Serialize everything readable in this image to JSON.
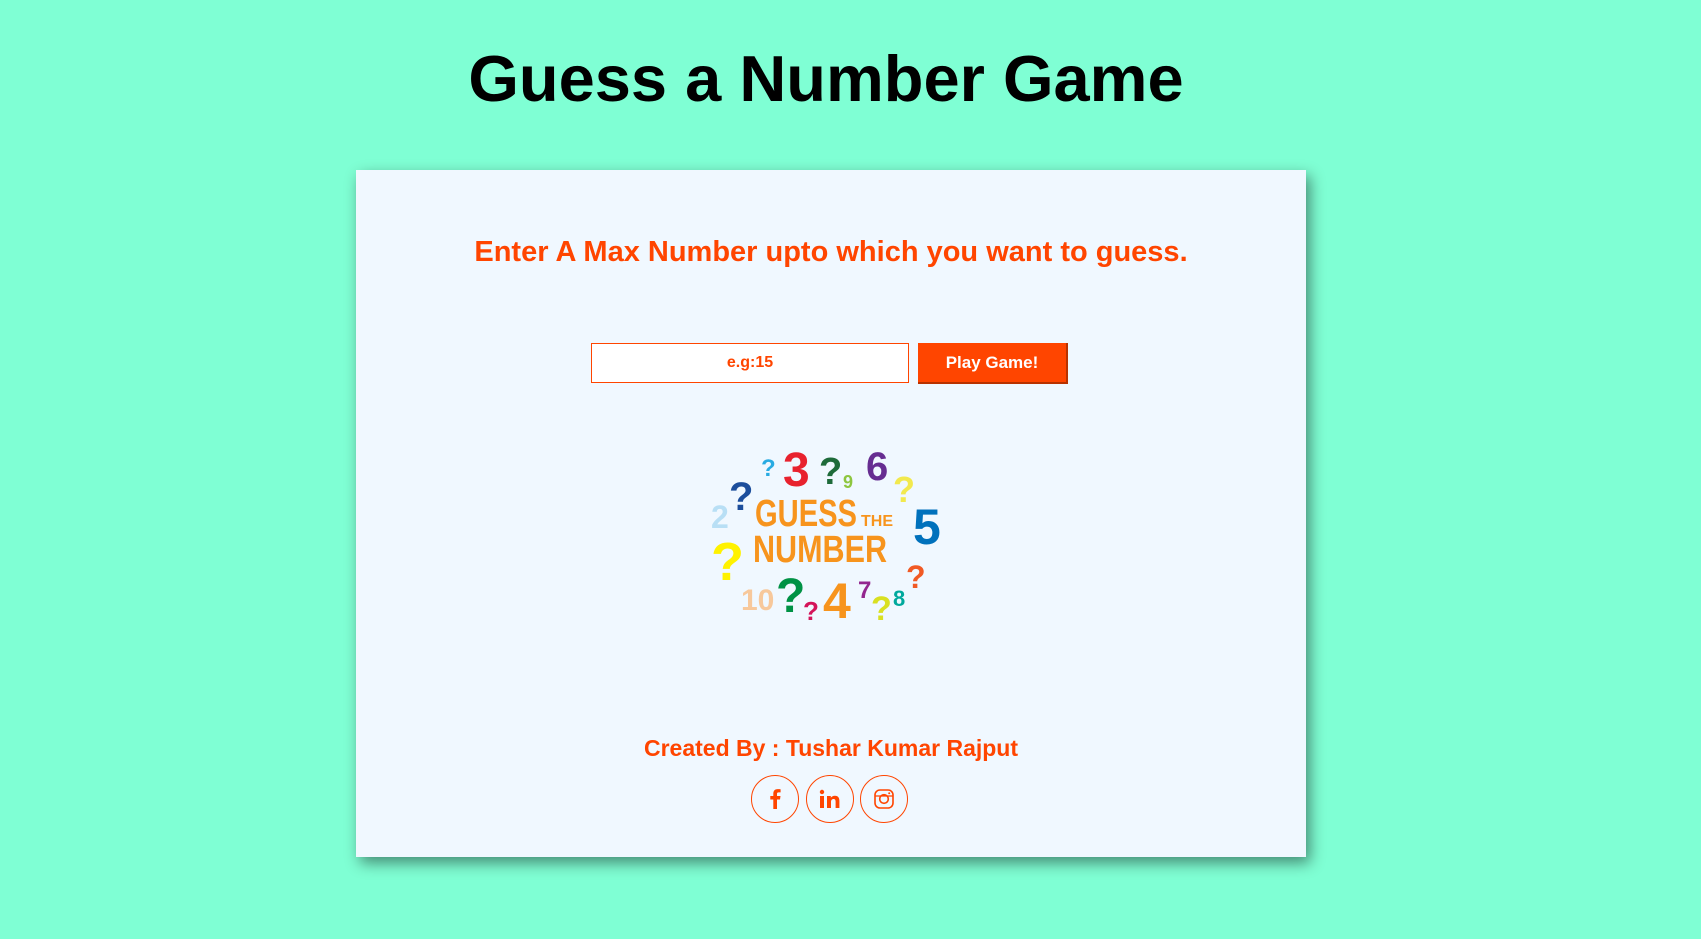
{
  "page": {
    "title": "Guess a Number Game"
  },
  "card": {
    "prompt": "Enter A Max Number upto which you want to guess.",
    "input": {
      "placeholder": "e.g:15",
      "value": ""
    },
    "play_button_label": "Play Game!",
    "logo": {
      "line1": "GUESS",
      "line1_small": "THE",
      "line2": "NUMBER"
    },
    "credit": "Created By : Tushar Kumar Rajput",
    "socials": [
      {
        "icon": "facebook-icon"
      },
      {
        "icon": "linkedin-icon"
      },
      {
        "icon": "instagram-icon"
      }
    ]
  },
  "colors": {
    "background": "#7fffd4",
    "card": "#f0f8ff",
    "accent": "#ff4500",
    "title": "#000000"
  }
}
